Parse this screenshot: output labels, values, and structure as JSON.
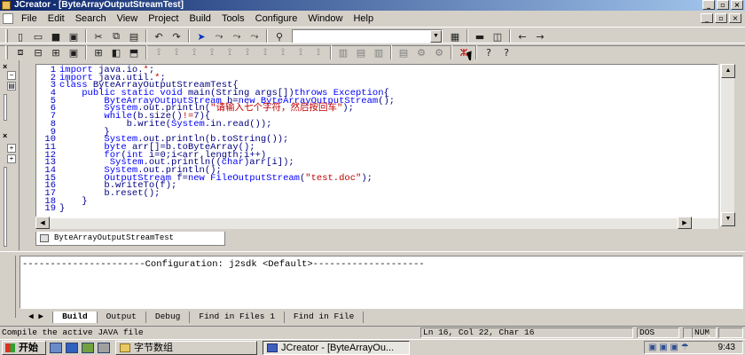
{
  "window": {
    "title": "JCreator - [ByteArrayOutputStreamTest]"
  },
  "menu": [
    "File",
    "Edit",
    "Search",
    "View",
    "Project",
    "Build",
    "Tools",
    "Configure",
    "Window",
    "Help"
  ],
  "toolbar1": {
    "icons": [
      "new-file-icon",
      "open-icon",
      "save-icon",
      "save-all-icon",
      "cut-icon",
      "copy-icon",
      "paste-icon",
      "undo-icon",
      "redo-icon",
      "bookmark-icon",
      "bookmark-next-icon",
      "bookmark-prev-icon",
      "bookmark-clear-icon",
      "find-icon"
    ],
    "search_value": "",
    "right_icons": [
      "show-output-icon",
      "workspace-icon",
      "back-icon",
      "forward-icon"
    ]
  },
  "toolbar2": {
    "icons": [
      "cascade-icon",
      "tile-h-icon",
      "tile-v-icon",
      "fullscreen-icon",
      "class-view-icon",
      "workspace-toggle-icon",
      "output-toggle-icon",
      "jdk-help-icon"
    ]
  },
  "code": {
    "lines": [
      {
        "n": "1",
        "t": [
          [
            "kw",
            "import"
          ],
          [
            "txt",
            " java.io."
          ],
          [
            "str",
            "*"
          ],
          [
            "txt",
            ";"
          ]
        ]
      },
      {
        "n": "2",
        "t": [
          [
            "kw",
            "import"
          ],
          [
            "txt",
            " java.util."
          ],
          [
            "str",
            "*"
          ],
          [
            "txt",
            ";"
          ]
        ]
      },
      {
        "n": "3",
        "t": [
          [
            "kw",
            "class"
          ],
          [
            "txt",
            " ByteArrayOutputStreamTest{"
          ]
        ]
      },
      {
        "n": "4",
        "t": [
          [
            "txt",
            "    "
          ],
          [
            "kw",
            "public static void"
          ],
          [
            "txt",
            " main(String args[])"
          ],
          [
            "kw",
            "throws"
          ],
          [
            "cls",
            " Exception"
          ],
          [
            "txt",
            "{"
          ]
        ]
      },
      {
        "n": "5",
        "t": [
          [
            "txt",
            "        "
          ],
          [
            "cls",
            "ByteArrayOutputStream"
          ],
          [
            "txt",
            " b="
          ],
          [
            "kw",
            "new"
          ],
          [
            "cls",
            " ByteArrayOutputStream"
          ],
          [
            "txt",
            "();"
          ]
        ]
      },
      {
        "n": "6",
        "t": [
          [
            "txt",
            "        "
          ],
          [
            "cls",
            "System"
          ],
          [
            "txt",
            ".out.println("
          ],
          [
            "str",
            "\"请输入七个字符，然后按回车\""
          ],
          [
            "txt",
            ");"
          ]
        ]
      },
      {
        "n": "7",
        "t": [
          [
            "txt",
            "        "
          ],
          [
            "kw",
            "while"
          ],
          [
            "txt",
            "(b.size()"
          ],
          [
            "str",
            "!="
          ],
          [
            "txt",
            "7){"
          ]
        ]
      },
      {
        "n": "8",
        "t": [
          [
            "txt",
            "            b.write("
          ],
          [
            "cls",
            "System"
          ],
          [
            "txt",
            ".in.read());"
          ]
        ]
      },
      {
        "n": "9",
        "t": [
          [
            "txt",
            "        }"
          ]
        ]
      },
      {
        "n": "10",
        "t": [
          [
            "txt",
            "        "
          ],
          [
            "cls",
            "System"
          ],
          [
            "txt",
            ".out.println(b.toString());"
          ]
        ]
      },
      {
        "n": "11",
        "t": [
          [
            "txt",
            "        "
          ],
          [
            "kw",
            "byte"
          ],
          [
            "txt",
            " arr[]=b.toByteArray();"
          ]
        ]
      },
      {
        "n": "12",
        "t": [
          [
            "txt",
            "        "
          ],
          [
            "kw",
            "for"
          ],
          [
            "txt",
            "("
          ],
          [
            "kw",
            "int"
          ],
          [
            "txt",
            " i=0;i<arr.length;i++)"
          ]
        ]
      },
      {
        "n": "13",
        "t": [
          [
            "txt",
            "         "
          ],
          [
            "cls",
            "System"
          ],
          [
            "txt",
            ".out.println(("
          ],
          [
            "kw",
            "char"
          ],
          [
            "txt",
            ")arr[i]);"
          ]
        ]
      },
      {
        "n": "14",
        "t": [
          [
            "txt",
            "        "
          ],
          [
            "cls",
            "System"
          ],
          [
            "txt",
            ".out.println();"
          ]
        ]
      },
      {
        "n": "15",
        "t": [
          [
            "txt",
            "        "
          ],
          [
            "cls",
            "OutputStream"
          ],
          [
            "txt",
            " f="
          ],
          [
            "kw",
            "new"
          ],
          [
            "cls",
            " FileOutputStream"
          ],
          [
            "txt",
            "("
          ],
          [
            "str",
            "\"test.doc\""
          ],
          [
            "txt",
            ");"
          ]
        ]
      },
      {
        "n": "16",
        "t": [
          [
            "txt",
            "        b.writeTo(f);"
          ]
        ]
      },
      {
        "n": "17",
        "t": [
          [
            "txt",
            "        b.reset();"
          ]
        ]
      },
      {
        "n": "18",
        "t": [
          [
            "txt",
            "    }"
          ]
        ]
      },
      {
        "n": "19",
        "t": [
          [
            "txt",
            "}"
          ]
        ]
      }
    ]
  },
  "doc_tab": "ByteArrayOutputStreamTest",
  "output": {
    "text": "----------------------Configuration: j2sdk <Default>--------------------"
  },
  "output_tabs": [
    "Build",
    "Output",
    "Debug",
    "Find in Files 1",
    "Find in File"
  ],
  "status": {
    "message": "Compile the active JAVA file",
    "position": "Ln 16, Col 22, Char 16",
    "dos": "DOS",
    "num": "NUM"
  },
  "taskbar": {
    "start": "开始",
    "tasks": [
      {
        "label": "字节数组",
        "pressed": false
      },
      {
        "label": "JCreator - [ByteArrayOu...",
        "pressed": true
      }
    ],
    "clock": "9:43"
  },
  "colors": {
    "titlebar": "#0a246a",
    "keyword": "#0000ff",
    "string": "#c00000"
  }
}
